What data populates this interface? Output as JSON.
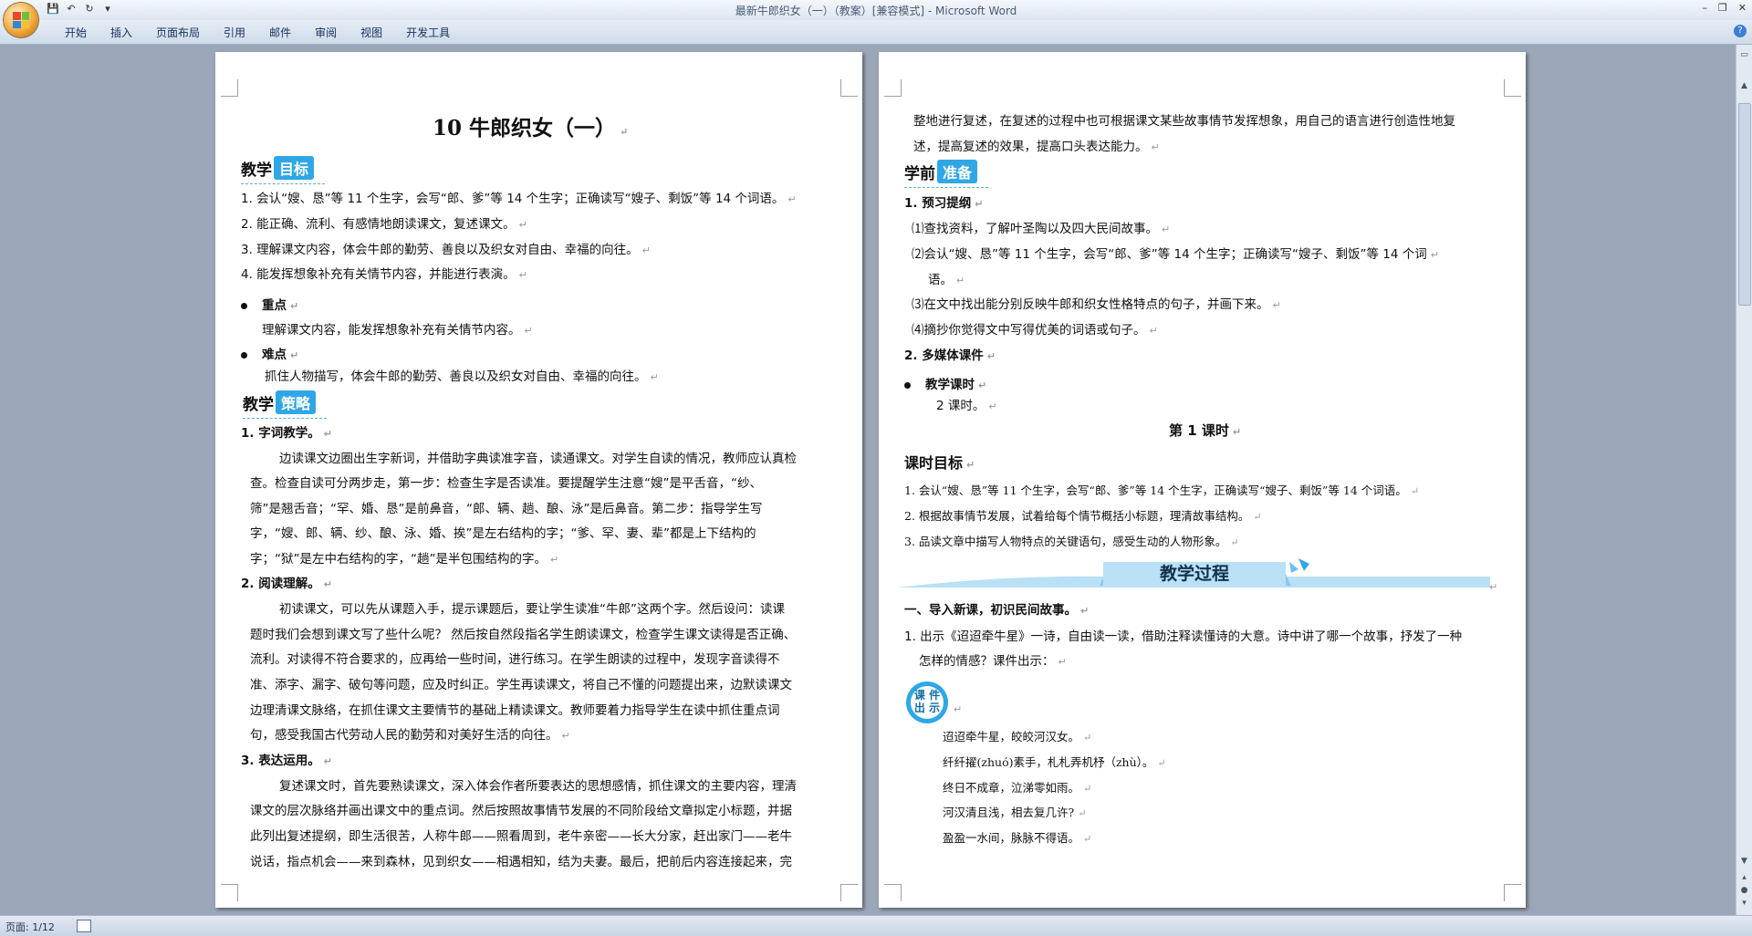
{
  "app": {
    "title": "最新牛郎织女（一）（教案）[兼容模式] - Microsoft Word",
    "tabs": [
      "开始",
      "插入",
      "页面布局",
      "引用",
      "邮件",
      "审阅",
      "视图",
      "开发工具"
    ],
    "window_controls": [
      "–",
      "❐",
      "✕"
    ],
    "help": "?"
  },
  "status": {
    "page": "页面: 1/12"
  },
  "page1": {
    "title": "10 牛郎织女（一）",
    "goal_head": {
      "label": "教学",
      "box": "目标"
    },
    "goals": [
      "1. 会认“嫂、恳”等 11 个生字，会写“郎、爹”等 14 个生字；正确读写“嫂子、剩饭”等 14 个词语。",
      "2. 能正确、流利、有感情地朗读课文，复述课文。",
      "3. 理解课文内容，体会牛郎的勤劳、善良以及织女对自由、幸福的向往。",
      "4. 能发挥想象补充有关情节内容，并能进行表演。"
    ],
    "key_point_label": "重点",
    "key_point_text": "理解课文内容，能发挥想象补充有关情节内容。",
    "difficult_label": "难点",
    "difficult_text": "抓住人物描写，体会牛郎的勤劳、善良以及织女对自由、幸福的向往。",
    "strategy_head": {
      "label": "教学",
      "box": "策略"
    },
    "s1_title": "1. 字词教学。",
    "s1_lines": [
      "边读课文边圈出生字新词，并借助字典读准字音，读通课文。对学生自读的情况，教师应认真检",
      "查。检查自读可分两步走，第一步：检查生字是否读准。要提醒学生注意“嫂”是平舌音，“纱、",
      "筛”是翘舌音；“罕、婚、恳”是前鼻音，“郎、辆、趟、酿、泳”是后鼻音。第二步：指导学生写",
      "字，“嫂、郎、辆、纱、酿、泳、婚、挨”是左右结构的字；“爹、罕、妻、辈”都是上下结构的",
      "字；“狱”是左中右结构的字，“趟”是半包围结构的字。"
    ],
    "s2_title": "2. 阅读理解。",
    "s2_lines": [
      "初读课文，可以先从课题入手，提示课题后，要让学生读准“牛郎”这两个字。然后设问：读课",
      "题时我们会想到课文写了些什么呢？ 然后按自然段指名学生朗读课文，检查学生课文读得是否正确、",
      "流利。对读得不符合要求的，应再给一些时间，进行练习。在学生朗读的过程中，发现字音读得不",
      "准、添字、漏字、破句等问题，应及时纠正。学生再读课文，将自己不懂的问题提出来，边默读课文",
      "边理清课文脉络，在抓住课文主要情节的基础上精读课文。教师要着力指导学生在读中抓住重点词",
      "句，感受我国古代劳动人民的勤劳和对美好生活的向往。"
    ],
    "s3_title": "3. 表达运用。",
    "s3_lines": [
      "复述课文时，首先要熟读课文，深入体会作者所要表达的思想感情，抓住课文的主要内容，理清",
      "课文的层次脉络并画出课文中的重点词。然后按照故事情节发展的不同阶段给文章拟定小标题，并据",
      "此列出复述提纲，即生活很苦，人称牛郎——照看周到，老牛亲密——长大分家，赶出家门——老牛",
      "说话，指点机会——来到森林，见到织女——相遇相知，结为夫妻。最后，把前后内容连接起来，完"
    ]
  },
  "page2": {
    "intro_lines": [
      "整地进行复述，在复述的过程中也可根据课文某些故事情节发挥想象，用自己的语言进行创造性地复",
      "述，提高复述的效果，提高口头表达能力。"
    ],
    "prep_head": {
      "label": "学前",
      "box": "准备"
    },
    "p1_title": "1. 预习提纲",
    "p1_items": [
      "⑴查找资料，了解叶圣陶以及四大民间故事。",
      "⑵会认“嫂、恳”等 11 个生字，会写“郎、爹”等 14 个生字；正确读写“嫂子、剩饭”等 14 个词",
      "语。",
      "⑶在文中找出能分别反映牛郎和织女性格特点的句子，并画下来。",
      "⑷摘抄你觉得文中写得优美的词语或句子。"
    ],
    "p2_title": "2. 多媒体课件",
    "hours_label": "教学课时",
    "hours_text": "2 课时。",
    "lesson_title": "第 1 课时",
    "lesson_goal_head": "课时目标",
    "lesson_goals": [
      "1. 会认“嫂、恳”等 11 个生字，会写“郎、爹”等 14 个生字，正确读写“嫂子、剩饭”等 14 个词语。",
      "2. 根据故事情节发展，试着给每个情节概括小标题，理清故事结构。",
      "3. 品读文章中描写人物特点的关键语句，感受生动的人物形象。"
    ],
    "process_banner": "教学过程",
    "step1": "一、导入新课，初识民间故事。",
    "step1_lines": [
      "1. 出示《迢迢牵牛星》一诗，自由读一读，借助注释读懂诗的大意。诗中讲了哪一个故事，抒发了一种",
      "怎样的情感？课件出示："
    ],
    "courseware_badge": [
      "课 件",
      "出 示"
    ],
    "poem": [
      "迢迢牵牛星，皎皎河汉女。",
      "纤纤擢(zhuó)素手，札札弄机杼（zhù）。",
      "终日不成章，泣涕零如雨。",
      "河汉清且浅，相去复几许?",
      "盈盈一水间，脉脉不得语。"
    ]
  },
  "colors": {
    "accent": "#2fa7e6",
    "banner": "#b9e0f5",
    "workspace": "#9ba7b8"
  },
  "icons": [
    "office-button-icon",
    "save-icon",
    "undo-icon",
    "redo-icon",
    "customize-icon",
    "help-icon",
    "minimize-icon",
    "restore-icon",
    "close-icon",
    "paragraph-mark-icon",
    "bullet-icon"
  ]
}
